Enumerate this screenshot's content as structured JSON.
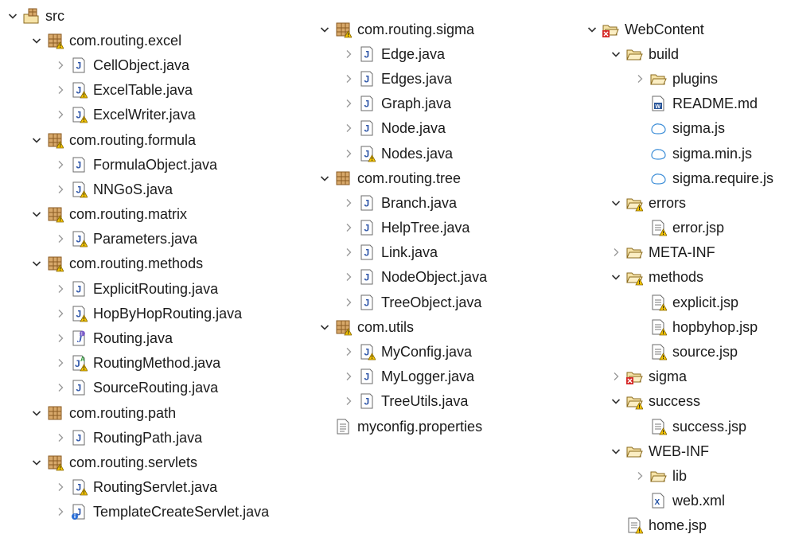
{
  "columns": [
    [
      {
        "label": "src",
        "depth": 0,
        "expander": "open",
        "icon": "source-folder-icon"
      },
      {
        "label": "com.routing.excel",
        "depth": 1,
        "expander": "open",
        "icon": "package-warning-icon"
      },
      {
        "label": "CellObject.java",
        "depth": 2,
        "expander": "closed",
        "icon": "java-file-icon"
      },
      {
        "label": "ExcelTable.java",
        "depth": 2,
        "expander": "closed",
        "icon": "java-file-warning-icon"
      },
      {
        "label": "ExcelWriter.java",
        "depth": 2,
        "expander": "closed",
        "icon": "java-file-warning-icon"
      },
      {
        "label": "com.routing.formula",
        "depth": 1,
        "expander": "open",
        "icon": "package-warning-icon"
      },
      {
        "label": "FormulaObject.java",
        "depth": 2,
        "expander": "closed",
        "icon": "java-file-icon"
      },
      {
        "label": "NNGoS.java",
        "depth": 2,
        "expander": "closed",
        "icon": "java-file-warning-icon"
      },
      {
        "label": "com.routing.matrix",
        "depth": 1,
        "expander": "open",
        "icon": "package-warning-icon"
      },
      {
        "label": "Parameters.java",
        "depth": 2,
        "expander": "closed",
        "icon": "java-file-warning-icon"
      },
      {
        "label": "com.routing.methods",
        "depth": 1,
        "expander": "open",
        "icon": "package-warning-icon"
      },
      {
        "label": "ExplicitRouting.java",
        "depth": 2,
        "expander": "closed",
        "icon": "java-file-icon"
      },
      {
        "label": "HopByHopRouting.java",
        "depth": 2,
        "expander": "closed",
        "icon": "java-file-warning-icon"
      },
      {
        "label": "Routing.java",
        "depth": 2,
        "expander": "closed",
        "icon": "java-interface-icon"
      },
      {
        "label": "RoutingMethod.java",
        "depth": 2,
        "expander": "closed",
        "icon": "java-abstract-warning-icon"
      },
      {
        "label": "SourceRouting.java",
        "depth": 2,
        "expander": "closed",
        "icon": "java-file-icon"
      },
      {
        "label": "com.routing.path",
        "depth": 1,
        "expander": "open",
        "icon": "package-icon"
      },
      {
        "label": "RoutingPath.java",
        "depth": 2,
        "expander": "closed",
        "icon": "java-file-icon"
      },
      {
        "label": "com.routing.servlets",
        "depth": 1,
        "expander": "open",
        "icon": "package-warning-icon"
      },
      {
        "label": "RoutingServlet.java",
        "depth": 2,
        "expander": "closed",
        "icon": "java-file-warning-icon"
      },
      {
        "label": "TemplateCreateServlet.java",
        "depth": 2,
        "expander": "closed",
        "icon": "java-file-info-icon"
      }
    ],
    [
      {
        "label": "com.routing.sigma",
        "depth": 0,
        "expander": "open",
        "icon": "package-warning-icon"
      },
      {
        "label": "Edge.java",
        "depth": 1,
        "expander": "closed",
        "icon": "java-file-icon"
      },
      {
        "label": "Edges.java",
        "depth": 1,
        "expander": "closed",
        "icon": "java-file-icon"
      },
      {
        "label": "Graph.java",
        "depth": 1,
        "expander": "closed",
        "icon": "java-file-icon"
      },
      {
        "label": "Node.java",
        "depth": 1,
        "expander": "closed",
        "icon": "java-file-icon"
      },
      {
        "label": "Nodes.java",
        "depth": 1,
        "expander": "closed",
        "icon": "java-file-warning-icon"
      },
      {
        "label": "com.routing.tree",
        "depth": 0,
        "expander": "open",
        "icon": "package-icon"
      },
      {
        "label": "Branch.java",
        "depth": 1,
        "expander": "closed",
        "icon": "java-file-icon"
      },
      {
        "label": "HelpTree.java",
        "depth": 1,
        "expander": "closed",
        "icon": "java-file-icon"
      },
      {
        "label": "Link.java",
        "depth": 1,
        "expander": "closed",
        "icon": "java-file-icon"
      },
      {
        "label": "NodeObject.java",
        "depth": 1,
        "expander": "closed",
        "icon": "java-file-icon"
      },
      {
        "label": "TreeObject.java",
        "depth": 1,
        "expander": "closed",
        "icon": "java-file-icon"
      },
      {
        "label": "com.utils",
        "depth": 0,
        "expander": "open",
        "icon": "package-warning-icon"
      },
      {
        "label": "MyConfig.java",
        "depth": 1,
        "expander": "closed",
        "icon": "java-file-warning-icon"
      },
      {
        "label": "MyLogger.java",
        "depth": 1,
        "expander": "closed",
        "icon": "java-file-icon"
      },
      {
        "label": "TreeUtils.java",
        "depth": 1,
        "expander": "closed",
        "icon": "java-file-icon"
      },
      {
        "label": "myconfig.properties",
        "depth": 0,
        "expander": "none",
        "icon": "text-file-icon"
      }
    ],
    [
      {
        "label": "WebContent",
        "depth": 0,
        "expander": "open",
        "icon": "folder-error-icon"
      },
      {
        "label": "build",
        "depth": 1,
        "expander": "open",
        "icon": "folder-open-icon"
      },
      {
        "label": "plugins",
        "depth": 2,
        "expander": "closed",
        "icon": "folder-open-icon"
      },
      {
        "label": "README.md",
        "depth": 2,
        "expander": "none",
        "icon": "word-file-icon"
      },
      {
        "label": "sigma.js",
        "depth": 2,
        "expander": "none",
        "icon": "js-file-icon"
      },
      {
        "label": "sigma.min.js",
        "depth": 2,
        "expander": "none",
        "icon": "js-file-icon"
      },
      {
        "label": "sigma.require.js",
        "depth": 2,
        "expander": "none",
        "icon": "js-file-icon"
      },
      {
        "label": "errors",
        "depth": 1,
        "expander": "open",
        "icon": "folder-warning-icon"
      },
      {
        "label": "error.jsp",
        "depth": 2,
        "expander": "none",
        "icon": "jsp-warning-icon"
      },
      {
        "label": "META-INF",
        "depth": 1,
        "expander": "closed",
        "icon": "folder-open-icon"
      },
      {
        "label": "methods",
        "depth": 1,
        "expander": "open",
        "icon": "folder-warning-icon"
      },
      {
        "label": "explicit.jsp",
        "depth": 2,
        "expander": "none",
        "icon": "jsp-warning-icon"
      },
      {
        "label": "hopbyhop.jsp",
        "depth": 2,
        "expander": "none",
        "icon": "jsp-warning-icon"
      },
      {
        "label": "source.jsp",
        "depth": 2,
        "expander": "none",
        "icon": "jsp-warning-icon"
      },
      {
        "label": "sigma",
        "depth": 1,
        "expander": "closed",
        "icon": "folder-error-icon"
      },
      {
        "label": "success",
        "depth": 1,
        "expander": "open",
        "icon": "folder-warning-icon"
      },
      {
        "label": "success.jsp",
        "depth": 2,
        "expander": "none",
        "icon": "jsp-warning-icon"
      },
      {
        "label": "WEB-INF",
        "depth": 1,
        "expander": "open",
        "icon": "folder-open-icon"
      },
      {
        "label": "lib",
        "depth": 2,
        "expander": "closed",
        "icon": "folder-open-icon"
      },
      {
        "label": "web.xml",
        "depth": 2,
        "expander": "none",
        "icon": "xml-file-icon"
      },
      {
        "label": "home.jsp",
        "depth": 1,
        "expander": "none",
        "icon": "jsp-warning-icon"
      }
    ]
  ]
}
